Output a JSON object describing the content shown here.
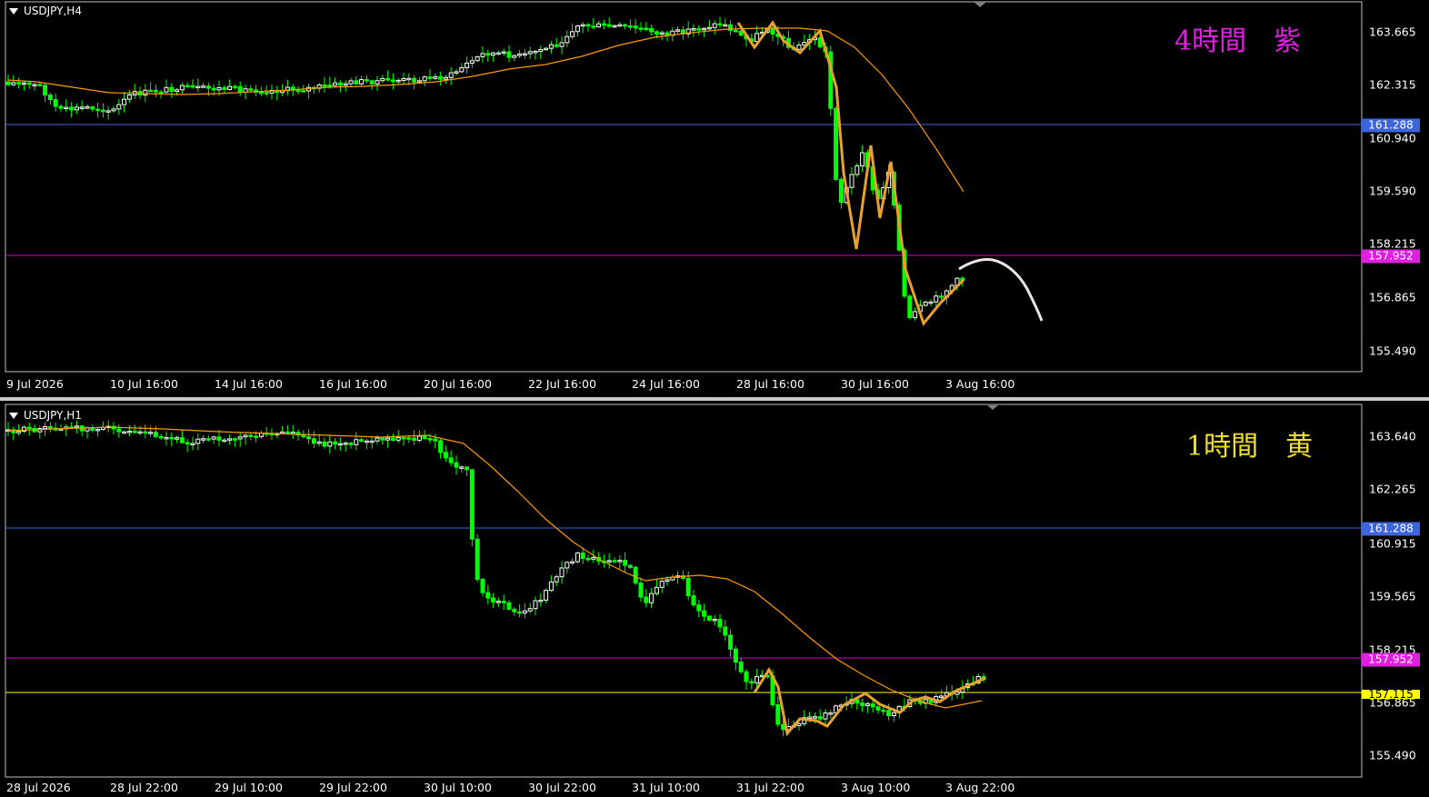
{
  "top": {
    "symbol": "USDJPY,H4",
    "tag": "4時間　紫",
    "tag_color": "#e020e0",
    "y_labels": [
      "163.665",
      "162.315",
      "160.940",
      "159.590",
      "158.215",
      "156.865",
      "155.490"
    ],
    "x_labels": [
      "9 Jul 2026",
      "10 Jul 16:00",
      "14 Jul 16:00",
      "16 Jul 16:00",
      "20 Jul 16:00",
      "22 Jul 16:00",
      "24 Jul 16:00",
      "28 Jul 16:00",
      "30 Jul 16:00",
      "3 Aug 16:00"
    ],
    "level_blue": "161.288",
    "level_magenta": "157.952"
  },
  "bottom": {
    "symbol": "USDJPY,H1",
    "tag": "1時間　黄",
    "tag_color": "#f0e020",
    "y_labels": [
      "163.640",
      "162.265",
      "160.915",
      "159.565",
      "158.215",
      "156.865",
      "155.490"
    ],
    "x_labels": [
      "28 Jul 2026",
      "28 Jul 22:00",
      "29 Jul 10:00",
      "29 Jul 22:00",
      "30 Jul 10:00",
      "30 Jul 22:00",
      "31 Jul 10:00",
      "31 Jul 22:00",
      "3 Aug 10:00",
      "3 Aug 22:00"
    ],
    "level_blue": "161.288",
    "level_magenta": "157.952",
    "level_yellow": "157.115"
  },
  "colors": {
    "bull": "#ffffff",
    "bear": "#00ff00",
    "ma": "#ff9900",
    "zigzag": "#e8a030",
    "blue_line": "#3c64dc",
    "magenta_line": "#d000d0",
    "yellow_line": "#ffff00"
  }
}
